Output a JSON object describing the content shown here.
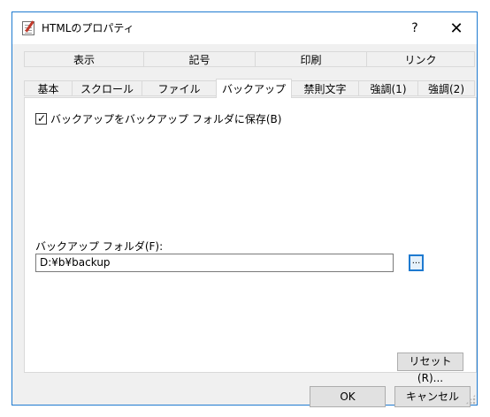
{
  "window": {
    "title": "HTMLのプロパティ",
    "help_label": "?",
    "close_label": "✕"
  },
  "tabs": {
    "row1": [
      "表示",
      "記号",
      "印刷",
      "リンク"
    ],
    "row2": [
      "基本",
      "スクロール",
      "ファイル",
      "バックアップ",
      "禁則文字",
      "強調(1)",
      "強調(2)"
    ],
    "active": "バックアップ"
  },
  "backup": {
    "checkbox_checked": true,
    "checkbox_label": "バックアップをバックアップ フォルダに保存(B)",
    "folder_label": "バックアップ フォルダ(F):",
    "folder_value": "D:¥b¥backup",
    "browse_label": "...",
    "reset_label": "リセット(R)..."
  },
  "footer": {
    "ok_label": "OK",
    "cancel_label": "キャンセル"
  },
  "colors": {
    "accent": "#1e7ad0",
    "window_bg": "#f0f0f0",
    "button_bg": "#e1e1e1"
  }
}
